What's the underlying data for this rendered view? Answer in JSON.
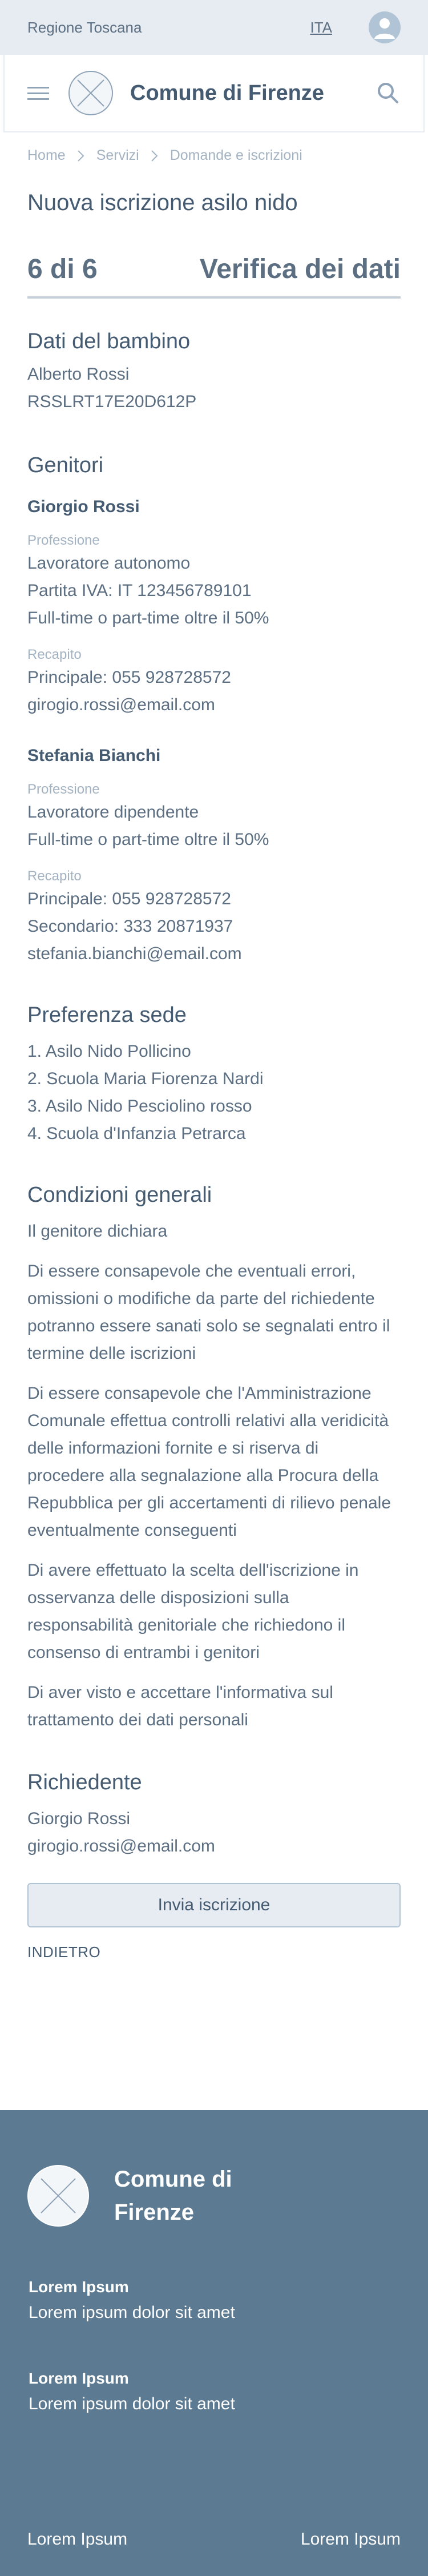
{
  "topbar": {
    "region": "Regione Toscana",
    "language": "ITA"
  },
  "header": {
    "brand": "Comune di Firenze"
  },
  "breadcrumb": [
    "Home",
    "Servizi",
    "Domande e iscrizioni"
  ],
  "page": {
    "title": "Nuova iscrizione asilo nido"
  },
  "stepper": {
    "count": "6 di 6",
    "label": "Verifica dei dati"
  },
  "child": {
    "title": "Dati del bambino",
    "name": "Alberto Rossi",
    "tax_code": "RSSLRT17E20D612P"
  },
  "parents": {
    "title": "Genitori",
    "list": [
      {
        "name": "Giorgio Rossi",
        "profession_label": "Professione",
        "profession_lines": [
          "Lavoratore autonomo",
          "Partita IVA: IT 123456789101",
          "Full-time o part-time oltre il 50%"
        ],
        "contact_label": "Recapito",
        "contact_lines": [
          "Principale: 055 928728572",
          "girogio.rossi@email.com"
        ]
      },
      {
        "name": "Stefania Bianchi",
        "profession_label": "Professione",
        "profession_lines": [
          "Lavoratore dipendente",
          "Full-time o part-time oltre il 50%"
        ],
        "contact_label": "Recapito",
        "contact_lines": [
          "Principale: 055 928728572",
          "Secondario: 333 20871937",
          "stefania.bianchi@email.com"
        ]
      }
    ]
  },
  "preferences": {
    "title": "Preferenza sede",
    "items": [
      "1. Asilo Nido Pollicino",
      "2. Scuola Maria Fiorenza Nardi",
      "3. Asilo Nido Pesciolino rosso",
      "4. Scuola d'Infanzia Petrarca"
    ]
  },
  "conditions": {
    "title": "Condizioni generali",
    "intro": "Il genitore dichiara",
    "paragraphs": [
      [
        "Di essere consapevole che eventuali errori,",
        "omissioni o modifiche da parte del richiedente",
        "potranno essere sanati solo se segnalati entro il",
        "termine delle iscrizioni"
      ],
      [
        "Di essere consapevole che l'Amministrazione",
        "Comunale effettua controlli relativi alla veridicità",
        "delle informazioni fornite e si riserva di",
        "procedere alla segnalazione alla Procura della",
        "Repubblica per gli accertamenti di rilievo penale",
        "eventualmente conseguenti"
      ],
      [
        "Di avere effettuato la scelta dell'iscrizione in",
        "osservanza delle disposizioni sulla",
        "responsabilità genitoriale che richiedono il",
        "consenso di entrambi i genitori"
      ],
      [
        "Di aver visto e accettare l'informativa sul",
        "trattamento dei dati personali"
      ]
    ]
  },
  "applicant": {
    "title": "Richiedente",
    "name": "Giorgio Rossi",
    "email": "girogio.rossi@email.com"
  },
  "actions": {
    "submit": "Invia iscrizione",
    "back": "INDIETRO"
  },
  "footer": {
    "brand_line1": "Comune di",
    "brand_line2": "Firenze",
    "blocks": [
      {
        "title": "Lorem Ipsum",
        "text": "Lorem ipsum dolor sit amet"
      },
      {
        "title": "Lorem Ipsum",
        "text": "Lorem ipsum dolor sit amet"
      }
    ],
    "bottom_left": "Lorem Ipsum",
    "bottom_right": "Lorem Ipsum"
  },
  "colors": {
    "topbar_bg": "#e6ecf2",
    "text_primary": "#455b71",
    "text_muted": "#a4b3c2",
    "footer_bg": "#5c7a91"
  },
  "icons": [
    "hamburger-icon",
    "logo-placeholder-icon",
    "search-icon",
    "user-avatar-icon",
    "chevron-right-icon"
  ]
}
